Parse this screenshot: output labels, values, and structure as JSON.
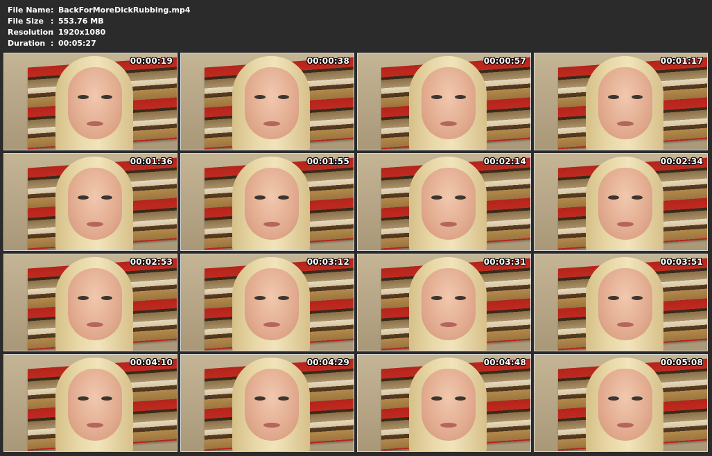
{
  "info": {
    "rows": [
      {
        "label": "File Name",
        "sep": ":",
        "value": "BackForMoreDickRubbing.mp4"
      },
      {
        "label": "File Size",
        "sep": ":",
        "value": "553.76 MB"
      },
      {
        "label": "Resolution",
        "sep": ":",
        "value": "1920x1080"
      },
      {
        "label": "Duration",
        "sep": ":",
        "value": "00:05:27"
      }
    ]
  },
  "thumbnails": [
    {
      "timestamp": "00:00:19"
    },
    {
      "timestamp": "00:00:38"
    },
    {
      "timestamp": "00:00:57"
    },
    {
      "timestamp": "00:01:17"
    },
    {
      "timestamp": "00:01:36"
    },
    {
      "timestamp": "00:01:55"
    },
    {
      "timestamp": "00:02:14"
    },
    {
      "timestamp": "00:02:34"
    },
    {
      "timestamp": "00:02:53"
    },
    {
      "timestamp": "00:03:12"
    },
    {
      "timestamp": "00:03:31"
    },
    {
      "timestamp": "00:03:51"
    },
    {
      "timestamp": "00:04:10"
    },
    {
      "timestamp": "00:04:29"
    },
    {
      "timestamp": "00:04:48"
    },
    {
      "timestamp": "00:05:08"
    }
  ]
}
